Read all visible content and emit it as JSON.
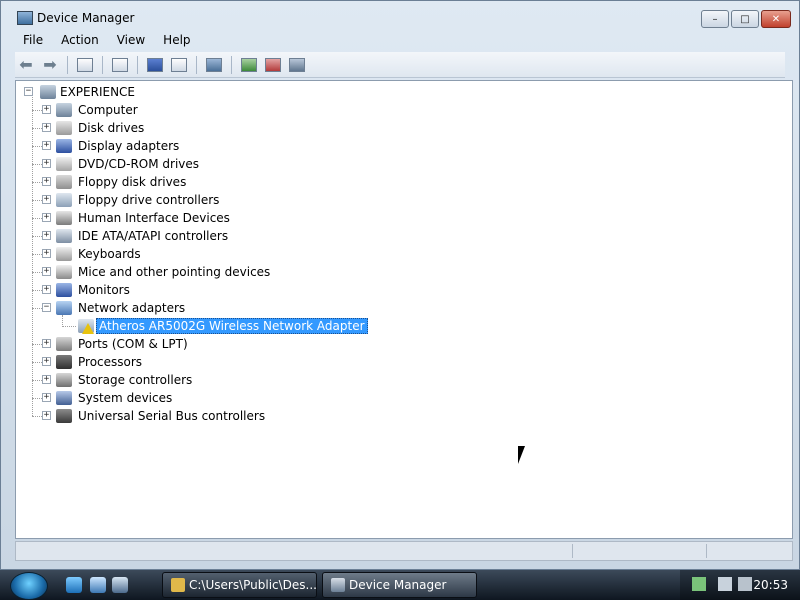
{
  "window": {
    "title": "Device Manager",
    "buttons": {
      "minimize": "–",
      "maximize": "□",
      "close": "✕"
    }
  },
  "menu": [
    {
      "label": "File",
      "underline": "F"
    },
    {
      "label": "Action",
      "underline": "A"
    },
    {
      "label": "View",
      "underline": "V"
    },
    {
      "label": "Help",
      "underline": "H"
    }
  ],
  "toolbar": {
    "back_icon": "back-arrow-icon",
    "forward_icon": "forward-arrow-icon",
    "buttons": [
      "show-hide-console-tree-icon",
      "properties-icon",
      "help-icon",
      "action-pane-icon",
      "scan-hardware-icon",
      "update-driver-icon",
      "uninstall-icon",
      "disable-icon"
    ]
  },
  "tree": {
    "root": "EXPERIENCE",
    "items": [
      {
        "label": "Computer",
        "icon": "computer-icon"
      },
      {
        "label": "Disk drives",
        "icon": "disk-drive-icon"
      },
      {
        "label": "Display adapters",
        "icon": "display-adapter-icon"
      },
      {
        "label": "DVD/CD-ROM drives",
        "icon": "dvd-icon"
      },
      {
        "label": "Floppy disk drives",
        "icon": "floppy-icon"
      },
      {
        "label": "Floppy drive controllers",
        "icon": "floppy-controller-icon"
      },
      {
        "label": "Human Interface Devices",
        "icon": "hid-icon"
      },
      {
        "label": "IDE ATA/ATAPI controllers",
        "icon": "ide-icon"
      },
      {
        "label": "Keyboards",
        "icon": "keyboard-icon"
      },
      {
        "label": "Mice and other pointing devices",
        "icon": "mouse-icon"
      },
      {
        "label": "Monitors",
        "icon": "monitor-icon"
      },
      {
        "label": "Network adapters",
        "icon": "network-icon",
        "expanded": true
      },
      {
        "label": "Ports (COM & LPT)",
        "icon": "port-icon"
      },
      {
        "label": "Processors",
        "icon": "processor-icon"
      },
      {
        "label": "Storage controllers",
        "icon": "storage-icon"
      },
      {
        "label": "System devices",
        "icon": "system-icon"
      },
      {
        "label": "Universal Serial Bus controllers",
        "icon": "usb-icon"
      }
    ],
    "child": {
      "label": "Atheros AR5002G Wireless Network Adapter",
      "warning": true,
      "selected": true
    }
  },
  "taskbar": {
    "tasks": [
      {
        "label": "C:\\Users\\Public\\Des...",
        "icon": "folder-icon"
      },
      {
        "label": "Device Manager",
        "icon": "device-manager-icon"
      }
    ],
    "clock": "20:53"
  },
  "colors": {
    "selection": "#3399ff",
    "warning": "#e8c30f"
  }
}
